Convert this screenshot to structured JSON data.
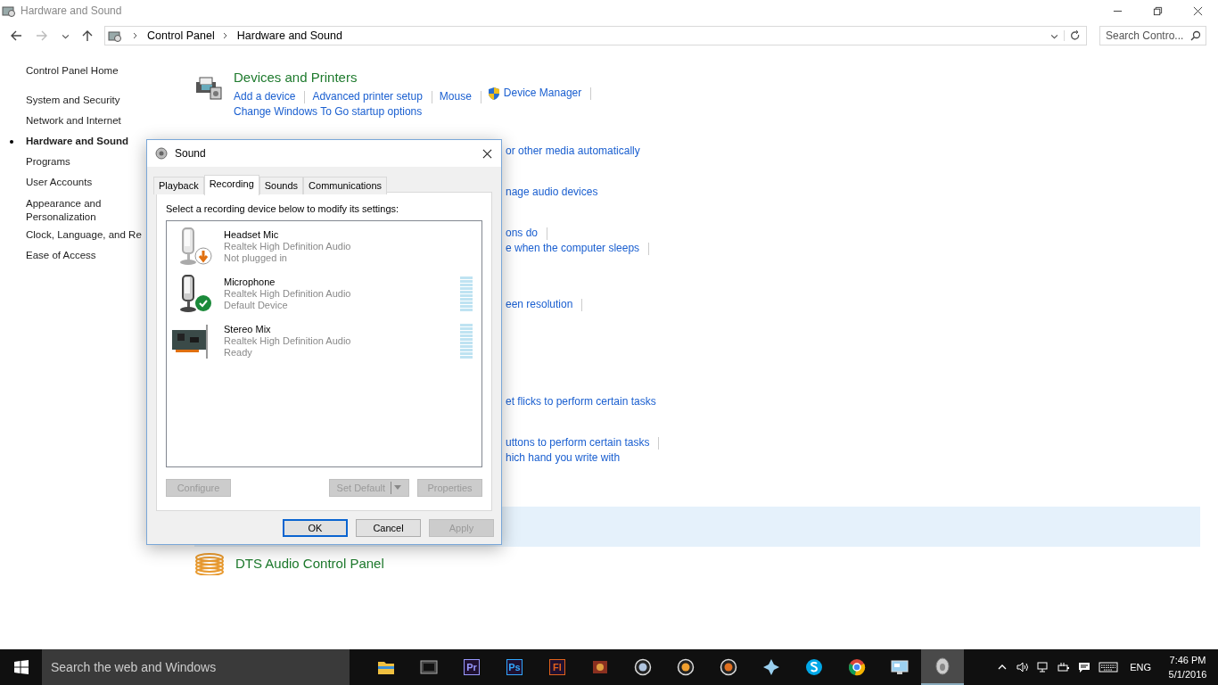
{
  "window": {
    "title": "Hardware and Sound"
  },
  "address_bar": {
    "breadcrumbs": [
      "Control Panel",
      "Hardware and Sound"
    ]
  },
  "search": {
    "placeholder": "Search Contro..."
  },
  "sidebar": {
    "items": [
      {
        "label": "Control Panel Home",
        "selected": false
      },
      {
        "label": "System and Security",
        "selected": false
      },
      {
        "label": "Network and Internet",
        "selected": false
      },
      {
        "label": "Hardware and Sound",
        "selected": true
      },
      {
        "label": "Programs",
        "selected": false
      },
      {
        "label": "User Accounts",
        "selected": false
      },
      {
        "label": "Appearance and Personalization",
        "selected": false
      },
      {
        "label": "Clock, Language, and Re",
        "selected": false
      },
      {
        "label": "Ease of Access",
        "selected": false
      }
    ]
  },
  "category": {
    "title": "Devices and Printers",
    "links": [
      [
        {
          "label": "Add a device",
          "shield": false,
          "separator_after": true
        },
        {
          "label": "Advanced printer setup",
          "shield": false,
          "separator_after": true
        },
        {
          "label": "Mouse",
          "shield": false,
          "separator_after": true
        },
        {
          "label": "Device Manager",
          "shield": true,
          "separator_after": true
        }
      ],
      [
        {
          "label": "Change Windows To Go startup options",
          "shield": false,
          "separator_after": false
        }
      ]
    ]
  },
  "partial_links": [
    {
      "label": "or other media automatically",
      "separator_after": false
    },
    {
      "label": "nage audio devices",
      "separator_after": false
    },
    {
      "label": "ons do",
      "separator_after": true
    },
    {
      "label": "e when the computer sleeps",
      "separator_after": true
    },
    {
      "label": "een resolution",
      "separator_after": true
    },
    {
      "label": "et flicks to perform certain tasks",
      "separator_after": false
    },
    {
      "label": "uttons to perform certain tasks",
      "separator_after": true
    },
    {
      "label": "hich hand you write with",
      "separator_after": false
    }
  ],
  "hover_band": true,
  "bottom_category": {
    "title": "DTS Audio Control Panel"
  },
  "dialog": {
    "title": "Sound",
    "tabs": [
      {
        "label": "Playback",
        "selected": false
      },
      {
        "label": "Recording",
        "selected": true
      },
      {
        "label": "Sounds",
        "selected": false
      },
      {
        "label": "Communications",
        "selected": false
      }
    ],
    "instruction": "Select a recording device below to modify its settings:",
    "devices": [
      {
        "kind": "mic",
        "name": "Headset Mic",
        "driver": "Realtek High Definition Audio",
        "status": "Not plugged in",
        "plugged_in": false,
        "default": false
      },
      {
        "kind": "mic",
        "name": "Microphone",
        "driver": "Realtek High Definition Audio",
        "status": "Default Device",
        "plugged_in": true,
        "default": true,
        "level": 0
      },
      {
        "kind": "card",
        "name": "Stereo Mix",
        "driver": "Realtek High Definition Audio",
        "status": "Ready",
        "plugged_in": true,
        "default": false,
        "level": 0
      }
    ],
    "buttons": [
      {
        "label": "Configure",
        "disabled": true,
        "split": false
      },
      {
        "label": "Set Default",
        "disabled": true,
        "split": true
      },
      {
        "label": "Properties",
        "disabled": true,
        "split": false
      }
    ],
    "footer_buttons": [
      {
        "label": "OK",
        "disabled": false,
        "default": true
      },
      {
        "label": "Cancel",
        "disabled": false,
        "default": false
      },
      {
        "label": "Apply",
        "disabled": true,
        "default": false
      }
    ]
  },
  "taskbar": {
    "search_placeholder": "Search the web and Windows",
    "apps": [
      {
        "kind": "folder",
        "active": false
      },
      {
        "kind": "video",
        "active": false
      },
      {
        "kind": "letters",
        "label": "Pr",
        "color": "#9999ff",
        "active": false
      },
      {
        "kind": "letters",
        "label": "Ps",
        "color": "#31a8ff",
        "active": false
      },
      {
        "kind": "letters",
        "label": "Fl",
        "color": "#e2621b",
        "active": false
      },
      {
        "kind": "game",
        "active": false
      },
      {
        "kind": "round",
        "color": "#b0c4de",
        "active": false
      },
      {
        "kind": "round",
        "color": "#f0a030",
        "active": false
      },
      {
        "kind": "round",
        "color": "#e07020",
        "active": false
      },
      {
        "kind": "star",
        "active": false
      },
      {
        "kind": "skype",
        "active": false
      },
      {
        "kind": "chrome",
        "active": false
      },
      {
        "kind": "monitor",
        "active": false
      },
      {
        "kind": "speaker",
        "active": true
      }
    ],
    "language": "ENG",
    "time": "7:46 PM",
    "date": "5/1/2016"
  }
}
